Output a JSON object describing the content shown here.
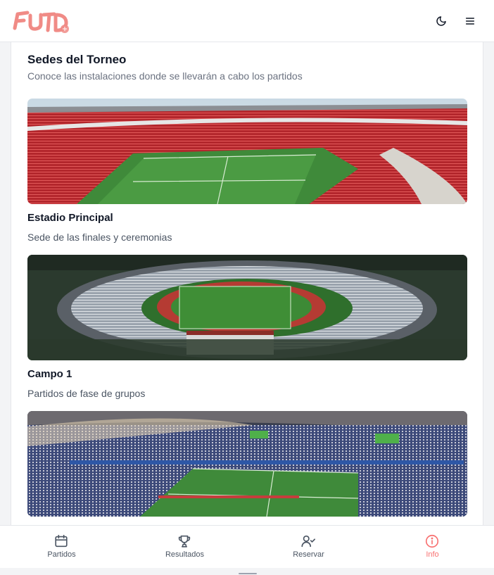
{
  "header": {
    "logo_icon": "futd-logo",
    "theme_icon": "moon-icon",
    "menu_icon": "hamburger-menu-icon"
  },
  "section": {
    "title": "Sedes del Torneo",
    "subtitle": "Conoce las instalaciones donde se llevarán a cabo los partidos"
  },
  "venues": [
    {
      "name": "Estadio Principal",
      "description": "Sede de las finales y ceremonias",
      "image": "stadium-photo-red-seats"
    },
    {
      "name": "Campo 1",
      "description": "Partidos de fase de grupos",
      "image": "stadium-photo-athletics-track"
    },
    {
      "name": "",
      "description": "",
      "image": "stadium-photo-crowd-night"
    }
  ],
  "bottom_nav": {
    "items": [
      {
        "label": "Partidos",
        "icon": "calendar-icon"
      },
      {
        "label": "Resultados",
        "icon": "trophy-icon"
      },
      {
        "label": "Reservar",
        "icon": "user-check-icon"
      },
      {
        "label": "Info",
        "icon": "info-icon",
        "active": true
      }
    ],
    "active_color": "#f87171"
  },
  "colors": {
    "accent": "#f87171",
    "text": "#111827",
    "muted": "#6b7280"
  }
}
